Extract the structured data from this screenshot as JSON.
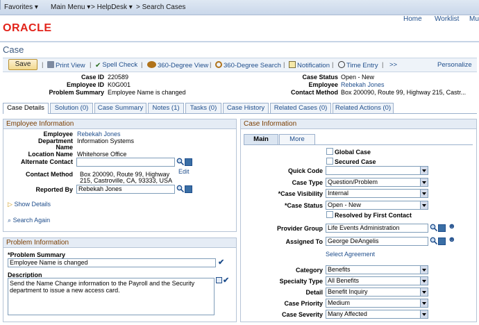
{
  "topnav": {
    "favorites": "Favorites",
    "main_menu": "Main Menu",
    "breadcrumb_1": "HelpDesk",
    "breadcrumb_2": "Search Cases",
    "home": "Home",
    "worklist": "Worklist",
    "overflow": "Mu"
  },
  "brand": "ORACLE",
  "page_title": "Case",
  "toolbar": {
    "save": "Save",
    "print_view": "Print View",
    "spell_check": "Spell Check",
    "view_360": "360-Degree View",
    "search_360": "360-Degree Search",
    "notification": "Notification",
    "time_entry": "Time Entry",
    "more": ">>",
    "personalize": "Personalize"
  },
  "header": {
    "case_id_label": "Case ID",
    "case_id": "220589",
    "employee_id_label": "Employee ID",
    "employee_id": "K0G001",
    "problem_summary_label": "Problem Summary",
    "problem_summary": "Employee Name is changed",
    "case_status_label": "Case Status",
    "case_status": "Open - New",
    "employee_label": "Employee",
    "employee": "Rebekah Jones",
    "contact_method_label": "Contact Method",
    "contact_method": "Box 200090, Route 99, Highway 215, Castr..."
  },
  "tabs": [
    "Case Details",
    "Solution (0)",
    "Case Summary",
    "Notes (1)",
    "Tasks (0)",
    "Case History",
    "Related Cases (0)",
    "Related Actions (0)"
  ],
  "employee_info": {
    "title": "Employee Information",
    "employee_label": "Employee",
    "employee": "Rebekah Jones",
    "department_label": "Department",
    "department": "Information Systems",
    "name_label": "Name",
    "location_label": "Location Name",
    "location": "Whitehorse Office",
    "alternate_contact_label": "Alternate Contact",
    "alternate_contact": "",
    "contact_method_label": "Contact Method",
    "contact_method_line1": "Box 200090, Route 99, Highway",
    "contact_method_line2": "215, Castroville, CA, 93333, USA",
    "edit": "Edit",
    "reported_by_label": "Reported By",
    "reported_by": "Rebekah Jones",
    "show_details": "Show Details",
    "search_again": "Search Again"
  },
  "problem_info": {
    "title": "Problem Information",
    "summary_label": "*Problem Summary",
    "summary": "Employee Name is changed",
    "description_label": "Description",
    "description": "Send the Name Change information to the Payroll and the Security department to issue a new access card."
  },
  "case_info": {
    "title": "Case Information",
    "subtab_main": "Main",
    "subtab_more": "More",
    "global_case": "Global Case",
    "secured_case": "Secured Case",
    "quick_code_label": "Quick Code",
    "quick_code": "",
    "case_type_label": "Case Type",
    "case_type": "Question/Problem",
    "case_visibility_label": "*Case Visibility",
    "case_visibility": "Internal",
    "case_status_label": "*Case Status",
    "case_status": "Open - New",
    "resolved_first_contact": "Resolved by First Contact",
    "provider_group_label": "Provider Group",
    "provider_group": "Life Events Administration",
    "assigned_to_label": "Assigned To",
    "assigned_to": "George DeAngelis",
    "select_agreement": "Select Agreement",
    "category_label": "Category",
    "category": "Benefits",
    "specialty_type_label": "Specialty Type",
    "specialty_type": "All Benefits",
    "detail_label": "Detail",
    "detail": "Benefit Inquiry",
    "case_priority_label": "Case Priority",
    "case_priority": "Medium",
    "case_severity_label": "Case Severity",
    "case_severity": "Many Affected"
  },
  "colors": {
    "brand_red": "#e2231a",
    "link_blue": "#1f4e8c",
    "section_title": "#7a3d00"
  }
}
